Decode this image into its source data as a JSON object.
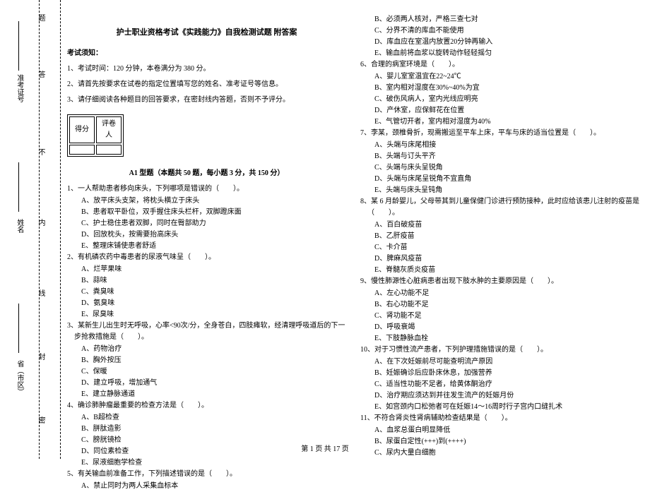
{
  "margin": {
    "seal1": "密",
    "seal2": "封",
    "seal3": "线",
    "seal4": "内",
    "seal5": "不",
    "seal6": "答",
    "seal7": "题",
    "field_province": "省（市区）",
    "field_name": "姓名",
    "field_ticket": "准考证号"
  },
  "title": "护士职业资格考试《实践能力》自我检测试题 附答案",
  "notice_head": "考试须知：",
  "instructions": [
    "1、考试时间：120 分钟，本卷满分为 380 分。",
    "2、请首先按要求在试卷的指定位置填写您的姓名、准考证号等信息。",
    "3、请仔细阅读各种题目的回答要求，在密封线内答题，否则不予评分。"
  ],
  "score_labels": {
    "score": "得分",
    "marker": "评卷人"
  },
  "section_a1": "A1 型题（本题共 50 题，每小题 3 分，共 150 分）",
  "left_questions": [
    {
      "q": "1、一人帮助患者移向床头，下列哪项是错误的（　　）。",
      "opts": [
        "A、放平床头支架，将枕头横立于床头",
        "B、患者取平卧位，双手握住床头栏杆，双脚蹬床面",
        "C、护士稳住患者双脚，同时在臀部助力",
        "D、回放枕头，按需要抬高床头",
        "E、整理床铺使患者舒适"
      ]
    },
    {
      "q": "2、有机磷农药中毒患者的尿液气味呈（　　）。",
      "opts": [
        "A、烂苹果味",
        "B、蒜味",
        "C、粪臭味",
        "D、氨臭味",
        "E、尿臭味"
      ]
    },
    {
      "q": "3、某新生儿出生时无呼吸，心率<90次/分，全身苍白，四肢瘫软，经清理呼吸道后的下一步抢救措施是（　　）。",
      "opts": [
        "A、药物治疗",
        "B、胸外按压",
        "C、保暖",
        "D、建立呼吸，增加通气",
        "E、建立静脉通道"
      ]
    },
    {
      "q": "4、确诊肺肿瘤最重要的检查方法是（　　）。",
      "opts": [
        "A、B超检查",
        "B、胼肽造影",
        "C、膀胱镜检",
        "D、同位素检查",
        "E、尿液细胞学检查"
      ]
    },
    {
      "q": "5、有关输血前准备工作，下列描述错误的是（　　）。",
      "opts": [
        "A、禁止同时为两人采集血标本"
      ]
    }
  ],
  "right_questions": [
    {
      "q": "",
      "opts": [
        "B、必须两人核对，严格三查七对",
        "C、分界不清的库血不能使用",
        "D、库血应在室温内放置20分钟再输入",
        "E、输血前将血浆以旋转动作轻轻摇匀"
      ]
    },
    {
      "q": "6、合理的病室环境是（　　）。",
      "opts": [
        "A、婴儿室室温宜在22~24℃",
        "B、室内相对湿度在30%~40%为宜",
        "C、破伤风病人，室内光线应明亮",
        "D、产休室，应保鲜花在位置",
        "E、气管切开者，室内相对湿度为40%"
      ]
    },
    {
      "q": "7、李某，颈椎骨折，现需搬运至平车上床，平车与床的适当位置是（　　）。",
      "opts": [
        "A、头端与床尾相接",
        "B、头端与订头平齐",
        "C、头端与床头呈锐角",
        "D、头端与床尾呈锐角不宜直角",
        "E、头端与床头呈钝角"
      ]
    },
    {
      "q": "8、某 6 月龄婴儿，父母带其到儿童保健门诊进行预防接种，此时应给该患儿注射的疫苗是（　　）。",
      "opts": [
        "A、百白破疫苗",
        "B、乙肝疫苗",
        "C、卡介苗",
        "D、脾麻风疫苗",
        "E、脊髓灰质炎疫苗"
      ]
    },
    {
      "q": "9、慢性肺源性心脏病患者出现下肢水肿的主要原因是（　　）。",
      "opts": [
        "A、左心功能不足",
        "B、右心功能不足",
        "C、肾功能不足",
        "D、呼吸衰竭",
        "E、下肢静脉血栓"
      ]
    },
    {
      "q": "10、对于习惯性流产患者，下列护理措施错误的是（　　）。",
      "opts": [
        "A、在下次妊娠前尽可能查明流产原因",
        "B、妊娠确诊后应卧床休息，加强营养",
        "C、适当性功能不足者，给黄体酮治疗",
        "D、治疗期应须达到并往发生流产的妊娠月份",
        "E、如宫颈内口松弛者可在妊娠14～16周时行子宫内口缝扎术"
      ]
    },
    {
      "q": "11、不符合肾炎性肾病辅助检查结果是（　　）。",
      "opts": [
        "A、血浆总蛋白明显降低",
        "B、尿蛋白定性(+++)到(++++)",
        "C、尿内大量白细胞"
      ]
    }
  ],
  "footer": "第 1 页 共 17 页"
}
